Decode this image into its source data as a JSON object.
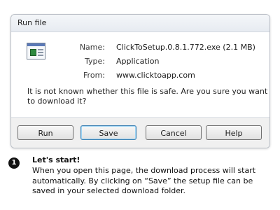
{
  "dialog": {
    "title": "Run file",
    "icon": "application-file-icon",
    "fields": [
      {
        "label": "Name:",
        "value": "ClickToSetup.0.8.1.772.exe (2.1 MB)"
      },
      {
        "label": "Type:",
        "value": "Application"
      },
      {
        "label": "From:",
        "value": "www.clicktoapp.com"
      }
    ],
    "warning": "It is not known whether this file is safe. Are you sure you want to download it?",
    "buttons": {
      "run": "Run",
      "save": "Save",
      "cancel": "Cancel",
      "help": "Help"
    },
    "default_button": "save"
  },
  "step": {
    "number": "1",
    "title": "Let's start!",
    "text": "When you open this page, the download process will start automatically. By clicking on “Save” the setup file can be saved in your selected download folder."
  }
}
